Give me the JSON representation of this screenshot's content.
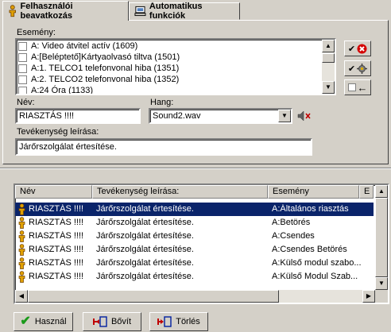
{
  "tabs": [
    {
      "label": "Felhasználói beavatkozás",
      "active": true
    },
    {
      "label": "Automatikus funkciók",
      "active": false
    }
  ],
  "event_section": {
    "label": "Esemény:",
    "items": [
      "A: Video átvitel actív (1609)",
      "A:[Beléptető]Kártyaolvasó  tiltva (1501)",
      "A:1. TELCO1 telefonvonal hiba (1351)",
      "A:2. TELCO2 telefonvonal hiba (1352)",
      "A:24 Óra (1133)"
    ]
  },
  "name_field": {
    "label": "Név:",
    "value": "RIASZTÁS !!!!"
  },
  "sound_field": {
    "label": "Hang:",
    "value": "Sound2.wav"
  },
  "description_field": {
    "label": "Tevékenység leírása:",
    "value": "Járőrszolgálat értesítése."
  },
  "table": {
    "columns": [
      "Név",
      "Tevékenység leírása:",
      "Esemény",
      "E"
    ],
    "rows": [
      {
        "name": "RIASZTÁS !!!!",
        "desc": "Járőrszolgálat értesítése.",
        "event": "A:Általános riasztás",
        "selected": true
      },
      {
        "name": "RIASZTÁS !!!!",
        "desc": "Járőrszolgálat értesítése.",
        "event": "A:Betörés",
        "selected": false
      },
      {
        "name": "RIASZTÁS !!!!",
        "desc": "Járőrszolgálat értesítése.",
        "event": "A:Csendes",
        "selected": false
      },
      {
        "name": "RIASZTÁS !!!!",
        "desc": "Járőrszolgálat értesítése.",
        "event": "A:Csendes Betörés",
        "selected": false
      },
      {
        "name": "RIASZTÁS !!!!",
        "desc": "Járőrszolgálat értesítése.",
        "event": "A:Külső modul szabo...",
        "selected": false
      },
      {
        "name": "RIASZTÁS !!!!",
        "desc": "Járőrszolgálat értesítése.",
        "event": "A:Külső Modul Szab...",
        "selected": false
      }
    ]
  },
  "buttons": {
    "ok": "Használ",
    "add": "Bővít",
    "delete": "Törlés"
  },
  "colors": {
    "selection": "#0a246a",
    "face": "#d4d0c8",
    "delete_red": "#d40000",
    "check_green": "#1a9a1a"
  }
}
